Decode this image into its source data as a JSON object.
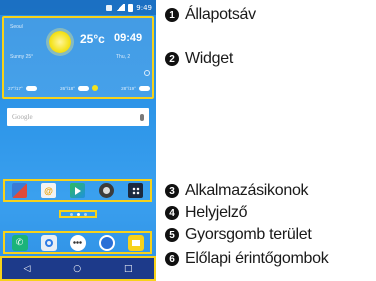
{
  "status_bar": {
    "time": "9:49"
  },
  "widget": {
    "location": "Seoul",
    "temperature": "25°c",
    "clock": "09:49",
    "subtitle_left": "Sunny 25°",
    "subtitle_right": "Thu, 2",
    "forecast": [
      {
        "label": "27°/17°"
      },
      {
        "label": "26°/18°"
      },
      {
        "label": "28°/19°"
      }
    ]
  },
  "search_bar": {
    "placeholder": "Google"
  },
  "nav_buttons": {
    "back": "◁",
    "home": "○",
    "recent": "□"
  },
  "legend": [
    {
      "number": "1",
      "label": "Állapotsáv"
    },
    {
      "number": "2",
      "label": "Widget"
    },
    {
      "number": "3",
      "label": "Alkalmazásikonok"
    },
    {
      "number": "4",
      "label": "Helyjelző"
    },
    {
      "number": "5",
      "label": "Gyorsgomb terület"
    },
    {
      "number": "6",
      "label": "Előlapi érintőgombok"
    }
  ],
  "colors": {
    "highlight": "#f7d21a",
    "wallpaper": "#2d95e8",
    "navbar": "#1d3a8a"
  }
}
